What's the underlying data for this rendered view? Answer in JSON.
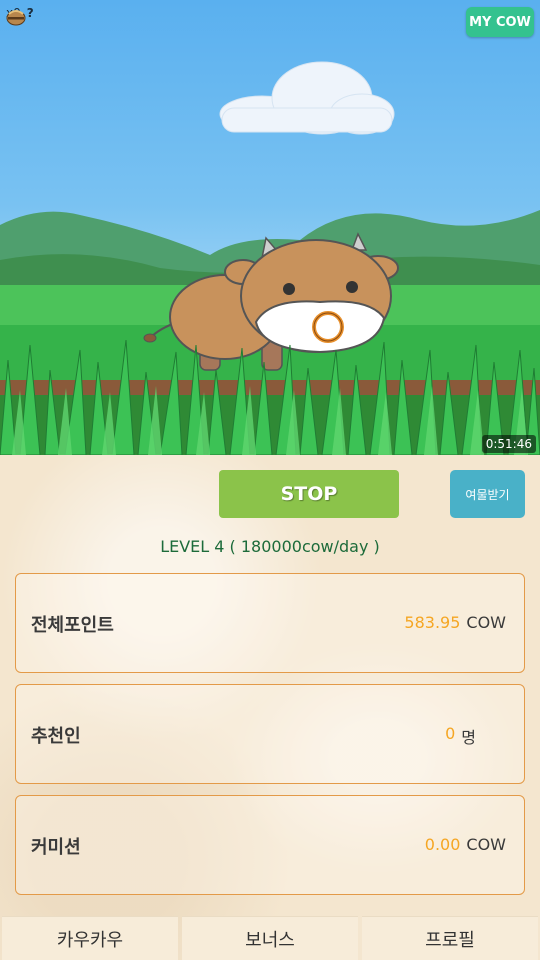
{
  "topbar": {
    "feed_icon": "hay-bundle-icon",
    "feed_count": "x0",
    "help_symbol": "?",
    "my_cow_button": "MY COW"
  },
  "scene": {
    "timer": "0:51:46"
  },
  "controls": {
    "stop_button": "STOP",
    "milk_button": "여물받기"
  },
  "level": {
    "text": "LEVEL  4 ( 180000cow/day )"
  },
  "cards": [
    {
      "label": "전체포인트",
      "value": "583.95",
      "unit": "COW"
    },
    {
      "label": "추천인",
      "value": "0",
      "unit": "명"
    },
    {
      "label": "커미션",
      "value": "0.00",
      "unit": "COW"
    }
  ],
  "tabs": [
    {
      "label": "카우카우"
    },
    {
      "label": "보너스"
    },
    {
      "label": "프로필"
    }
  ],
  "colors": {
    "accent_green": "#8bc34a",
    "teal_button": "#49b1c8",
    "my_cow_green": "#34c28f",
    "value_orange": "#f5a623",
    "level_green": "#1d6b3a",
    "card_border": "#e39a48"
  }
}
